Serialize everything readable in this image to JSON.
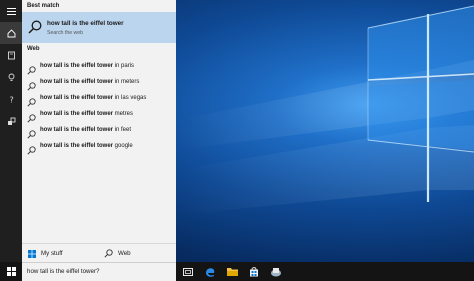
{
  "colors": {
    "accent": "#0078d7",
    "panel_bg": "#f2f2f2",
    "rail_bg": "#1f1f1f",
    "taskbar_bg": "#141414",
    "highlight": "#bcd5ee"
  },
  "rail": {
    "icons": [
      "hamburger-icon",
      "home-icon",
      "notebook-icon",
      "lightbulb-icon",
      "help-icon",
      "feedback-icon"
    ]
  },
  "search_panel": {
    "best_match_title": "Best match",
    "best_match": {
      "query": "how tall is the eiffel tower",
      "subtitle": "Search the web"
    },
    "web_title": "Web",
    "suggestions": [
      {
        "bold": "how tall is the eiffel tower",
        "rest": " in paris"
      },
      {
        "bold": "how tall is the eiffel tower",
        "rest": " in meters"
      },
      {
        "bold": "how tall is the eiffel tower",
        "rest": " in las vegas"
      },
      {
        "bold": "how tall is the eiffel tower",
        "rest": " metres"
      },
      {
        "bold": "how tall is the eiffel tower",
        "rest": " in feet"
      },
      {
        "bold": "how tall is the eiffel tower",
        "rest": " google"
      }
    ],
    "scope_left": "My stuff",
    "scope_right": "Web"
  },
  "taskbar": {
    "search_value": "how tall is the eiffel tower?",
    "pinned": [
      "task-view-icon",
      "edge-icon",
      "file-explorer-icon",
      "store-icon",
      "app-icon"
    ]
  }
}
